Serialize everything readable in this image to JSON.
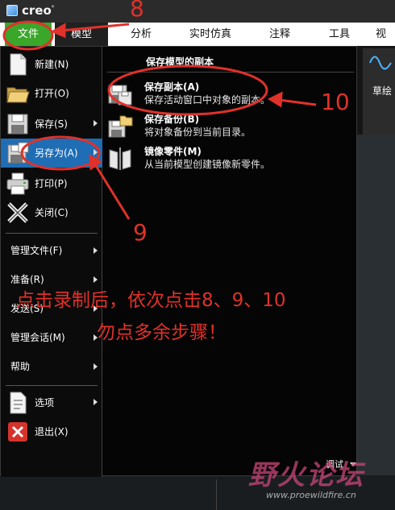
{
  "app": {
    "logo": "creo"
  },
  "tabs": [
    "文件",
    "模型",
    "分析",
    "实时仿真",
    "注释",
    "工具",
    "视"
  ],
  "toolbar": {
    "sketch_label": "草绘"
  },
  "file_menu": {
    "items": [
      {
        "label": "新建(N)"
      },
      {
        "label": "打开(O)"
      },
      {
        "label": "保存(S)"
      },
      {
        "label": "另存为(A)"
      },
      {
        "label": "打印(P)"
      },
      {
        "label": "关闭(C)"
      }
    ],
    "text_items": [
      {
        "label": "管理文件(F)"
      },
      {
        "label": "准备(R)"
      },
      {
        "label": "发送(S)"
      },
      {
        "label": "管理会话(M)"
      },
      {
        "label": "帮助"
      }
    ],
    "bottom_items": [
      {
        "label": "选项"
      },
      {
        "label": "退出(X)"
      }
    ]
  },
  "save_as_panel": {
    "heading": "保存模型的副本",
    "options": [
      {
        "title": "保存副本(A)",
        "desc": "保存活动窗口中对象的副本。"
      },
      {
        "title": "保存备份(B)",
        "desc": "将对象备份到当前目录。"
      },
      {
        "title": "镜像零件(M)",
        "desc": "从当前模型创建镜像新零件。"
      }
    ]
  },
  "status": {
    "debug_label": "调试"
  },
  "annotations": {
    "n8": "8",
    "n9": "9",
    "n10": "10",
    "line1": "点击录制后，依次点击8、9、10",
    "line2": "勿点多余步骤！"
  },
  "watermark": {
    "main": "野火论坛",
    "sub": "www.proewildfire.cn"
  },
  "colors": {
    "accent_green": "#3aa62a",
    "highlight_blue": "#1f6db4",
    "annotation_red": "#e0312a"
  }
}
